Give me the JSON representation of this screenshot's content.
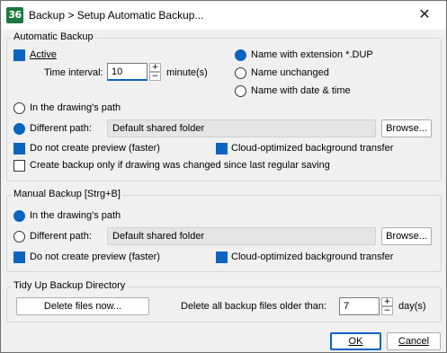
{
  "window": {
    "title": "Backup > Setup Automatic Backup...",
    "app_icon_text": "36",
    "close_glyph": "✕"
  },
  "auto": {
    "group_label": "Automatic Backup",
    "active_label": "Active",
    "interval_label": "Time interval:",
    "interval_value": "10",
    "interval_unit": "minute(s)",
    "name_ext_label": "Name with extension *.DUP",
    "name_unchanged_label": "Name unchanged",
    "name_date_label": "Name with date & time",
    "in_path_label": "In the drawing's path",
    "diff_path_label": "Different path:",
    "path_value": "Default shared folder",
    "browse_label": "Browse...",
    "no_preview_label": "Do not create preview (faster)",
    "cloud_label": "Cloud-optimized background transfer",
    "only_changed_label": "Create backup only if drawing was changed since last regular saving"
  },
  "manual": {
    "group_label": "Manual Backup [Strg+B]",
    "in_path_label": "In the drawing's path",
    "diff_path_label": "Different path:",
    "path_value": "Default shared folder",
    "browse_label": "Browse...",
    "no_preview_label": "Do not create preview (faster)",
    "cloud_label": "Cloud-optimized background transfer"
  },
  "tidy": {
    "group_label": "Tidy Up Backup Directory",
    "delete_button": "Delete files now...",
    "older_than_label": "Delete all backup files older than:",
    "days_value": "7",
    "days_unit": "day(s)"
  },
  "footer": {
    "ok_label": "OK",
    "cancel_label": "Cancel"
  },
  "icons": {
    "spin_up": "+",
    "spin_down": "−"
  },
  "colors": {
    "accent": "#0a64c0",
    "app_icon": "#1b7a3e"
  }
}
